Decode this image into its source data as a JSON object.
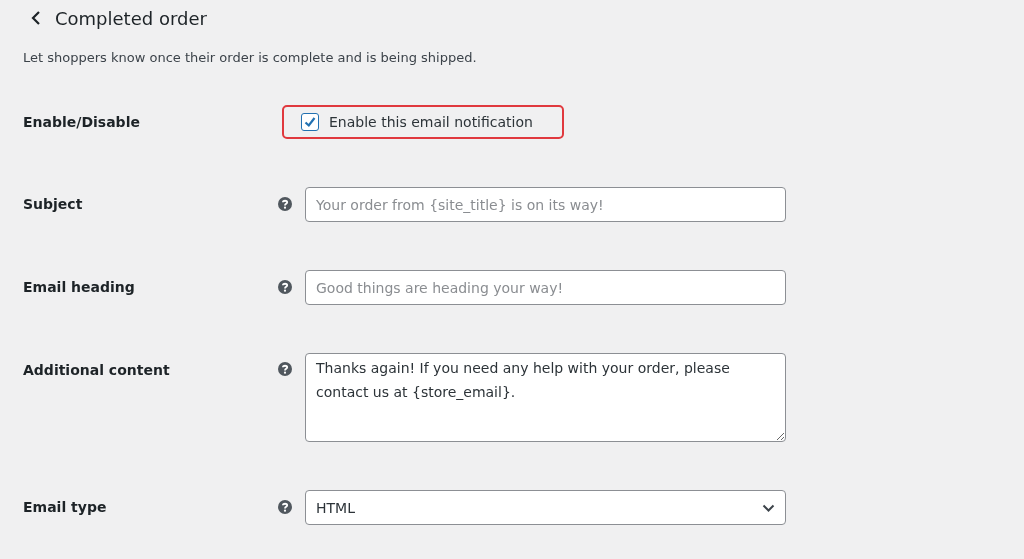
{
  "header": {
    "title": "Completed order",
    "description": "Let shoppers know once their order is complete and is being shipped."
  },
  "fields": [
    {
      "kind": "checkbox",
      "label": "Enable/Disable",
      "option": "Enable this email notification",
      "checked": true,
      "highlighted": true
    },
    {
      "kind": "text",
      "label": "Subject",
      "placeholder": "Your order from {site_title} is on its way!"
    },
    {
      "kind": "text",
      "label": "Email heading",
      "placeholder": "Good things are heading your way!"
    },
    {
      "kind": "textarea",
      "label": "Additional content",
      "value": "Thanks again! If you need any help with your order, please contact us at {store_email}."
    },
    {
      "kind": "select",
      "label": "Email type",
      "value": "HTML"
    }
  ]
}
